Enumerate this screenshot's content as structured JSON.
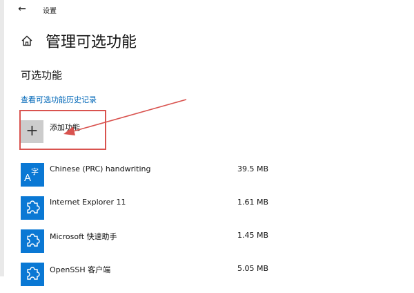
{
  "header": {
    "back_icon": "back-arrow-icon",
    "title": "设置"
  },
  "page": {
    "home_icon": "home-icon",
    "title": "管理可选功能"
  },
  "section": {
    "title": "可选功能",
    "history_link": "查看可选功能历史记录",
    "add_feature_label": "添加功能",
    "add_feature_icon": "plus-icon"
  },
  "features": [
    {
      "name": "Chinese (PRC) handwriting",
      "size": "39.5 MB",
      "icon": "language-icon"
    },
    {
      "name": "Internet Explorer 11",
      "size": "1.61 MB",
      "icon": "puzzle-icon"
    },
    {
      "name": "Microsoft 快速助手",
      "size": "1.45 MB",
      "icon": "puzzle-icon"
    },
    {
      "name": "OpenSSH 客户端",
      "size": "5.05 MB",
      "icon": "puzzle-icon"
    }
  ],
  "colors": {
    "accent": "#0a78d4",
    "link": "#0067b8",
    "annotation": "#d9534f"
  }
}
